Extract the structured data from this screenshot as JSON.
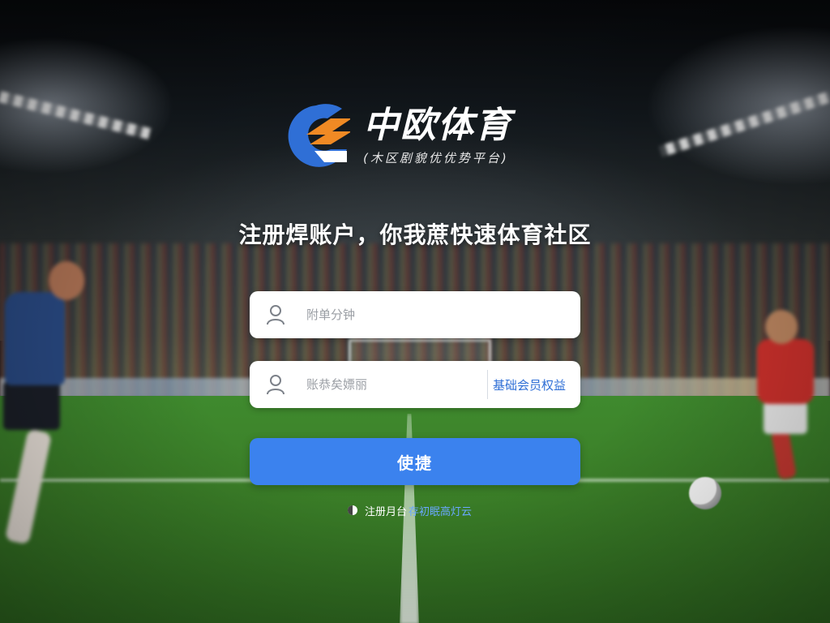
{
  "brand": {
    "name": "中欧体育",
    "slogan": "(木区剧貌优优势平台)",
    "colors": {
      "primary_blue": "#2f6fd6",
      "accent_orange": "#f08a24"
    }
  },
  "headline": "注册焊账户，你我蔗快速体育社区",
  "form": {
    "account_placeholder": "附单分钟",
    "password_placeholder": "账恭矣嫖丽",
    "benefit_link": "基础会员权益",
    "submit_label": "使捷"
  },
  "agreement": {
    "text": "注册月台",
    "link": "存初眠高灯云"
  },
  "icons": {
    "account_field": "user-icon",
    "password_field": "user-icon",
    "agreement": "radio-dot-icon",
    "logo": "brand-logo-icon"
  }
}
